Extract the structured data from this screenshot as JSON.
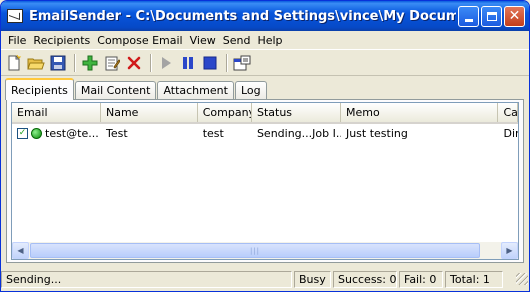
{
  "window": {
    "title": "EmailSender - C:\\Documents and Settings\\vince\\My Documents\\test...",
    "icon": "email-app-icon"
  },
  "menu": [
    "File",
    "Recipients",
    "Compose Email",
    "View",
    "Send",
    "Help"
  ],
  "toolbar": {
    "icons": [
      "new-icon",
      "open-folder-icon",
      "save-icon",
      "add-recipient-icon",
      "edit-recipient-icon",
      "delete-recipient-icon",
      "start-icon",
      "pause-icon",
      "stop-icon",
      "properties-icon"
    ]
  },
  "tabs": [
    "Recipients",
    "Mail Content",
    "Attachment",
    "Log"
  ],
  "table": {
    "columns": [
      "Email",
      "Name",
      "Company",
      "Status",
      "Memo",
      "Ca"
    ],
    "rows": [
      {
        "checked": true,
        "status_icon": "green-dot-icon",
        "email": "test@te...",
        "name": "Test",
        "company": "test",
        "status": "Sending...Job I...",
        "memo": "Just testing",
        "extra": "Dire"
      }
    ]
  },
  "statusbar": {
    "message": "Sending...",
    "state": "Busy",
    "success": "Success: 0",
    "fail": "Fail: 0",
    "total": "Total: 1"
  },
  "colors": {
    "titlebar": "#0a5bde",
    "accent_tab": "#ffc83c",
    "status_dot": "#0a8a0a"
  }
}
